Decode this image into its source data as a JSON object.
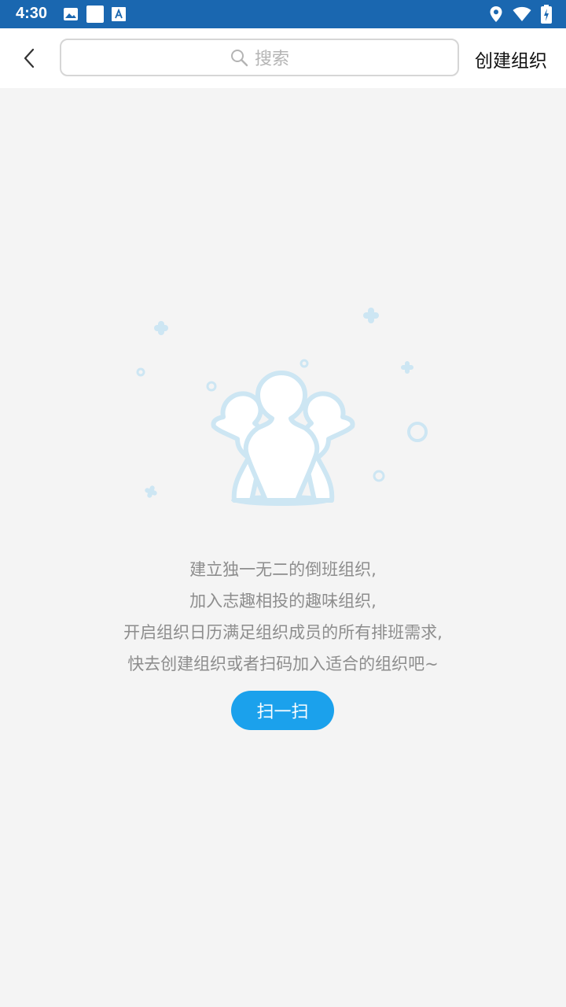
{
  "status_bar": {
    "time": "4:30",
    "left_icons": [
      "image-icon",
      "square-icon",
      "font-icon"
    ],
    "right_icons": [
      "location-icon",
      "wifi-icon",
      "battery-icon"
    ]
  },
  "header": {
    "back_icon": "chevron-left-icon",
    "search_placeholder": "搜索",
    "create_label": "创建组织"
  },
  "empty_state": {
    "illustration_icon": "group-people-icon",
    "lines": [
      "建立独一无二的倒班组织,",
      "加入志趣相投的趣味组织,",
      "开启组织日历满足组织成员的所有排班需求,",
      "快去创建组织或者扫码加入适合的组织吧~"
    ],
    "scan_label": "扫一扫"
  },
  "colors": {
    "status_bar": "#1a67b0",
    "accent": "#1ba1ec",
    "illustration": "#cde6f3"
  }
}
